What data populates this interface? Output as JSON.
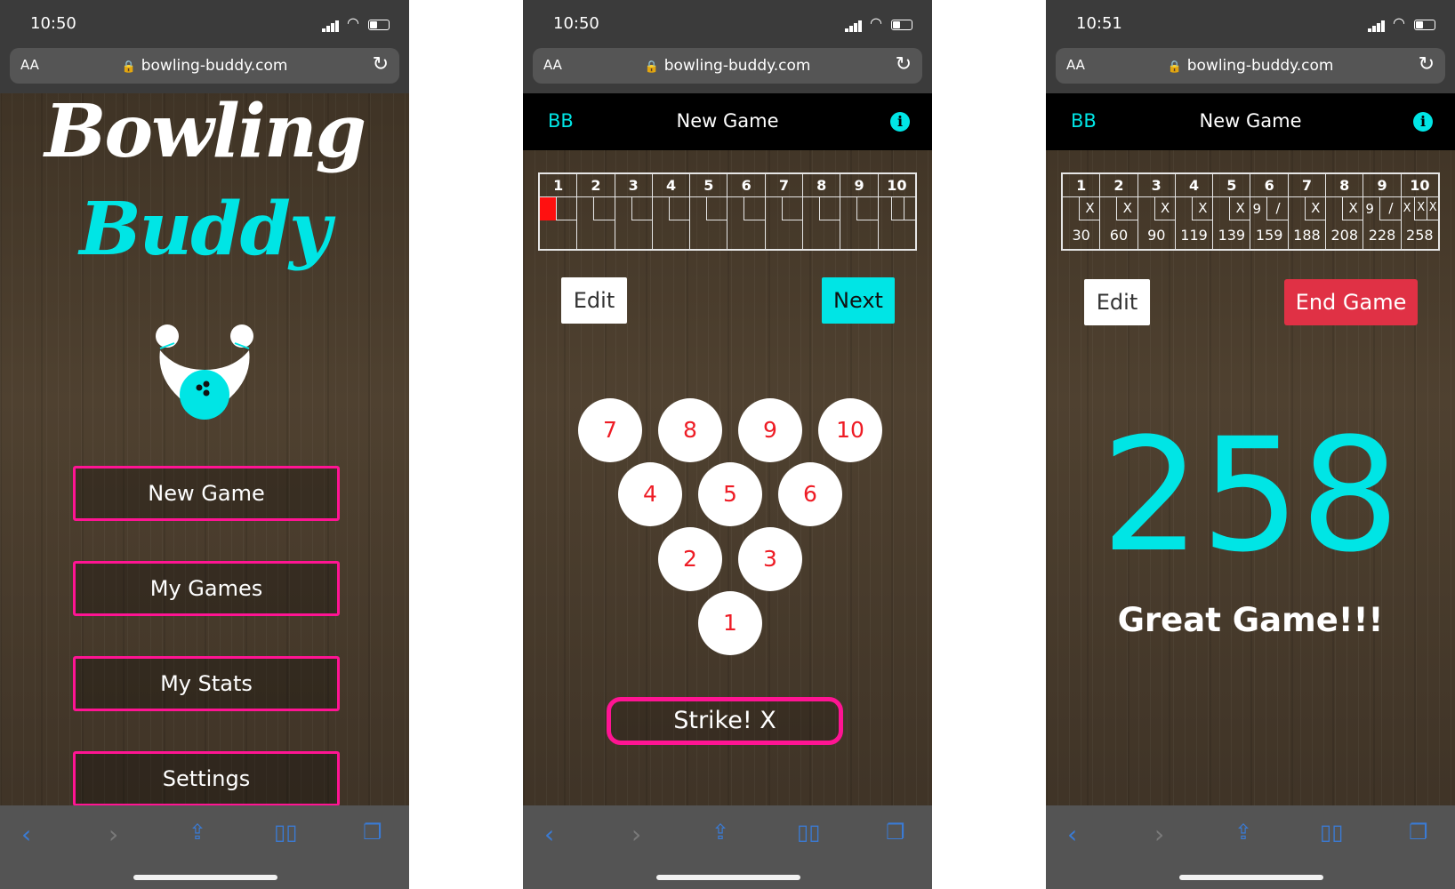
{
  "colors": {
    "accent": "#00e5e5",
    "menu_border": "#ff1493",
    "pin_text": "#ee1c25",
    "end_game": "#e03145",
    "current_marker": "#ff1010"
  },
  "browser": {
    "url": "bowling-buddy.com",
    "text_size_label": "AA"
  },
  "screens": [
    {
      "time": "10:50",
      "title_line1": "Bowling",
      "title_line2": "Buddy",
      "menu": [
        {
          "label": "New Game"
        },
        {
          "label": "My Games"
        },
        {
          "label": "My Stats"
        },
        {
          "label": "Settings"
        }
      ]
    },
    {
      "time": "10:50",
      "header": {
        "brand": "BB",
        "title": "New Game",
        "info_icon": "info-icon"
      },
      "frame_numbers": [
        "1",
        "2",
        "3",
        "4",
        "5",
        "6",
        "7",
        "8",
        "9",
        "10"
      ],
      "buttons": {
        "edit": "Edit",
        "next": "Next"
      },
      "pins": {
        "row4": [
          "7",
          "8",
          "9",
          "10"
        ],
        "row3": [
          "4",
          "5",
          "6"
        ],
        "row2": [
          "2",
          "3"
        ],
        "row1": [
          "1"
        ]
      },
      "strike_label": "Strike! X"
    },
    {
      "time": "10:51",
      "header": {
        "brand": "BB",
        "title": "New Game",
        "info_icon": "info-icon"
      },
      "frames": [
        {
          "num": "1",
          "r1": "",
          "r2": "X",
          "total": "30"
        },
        {
          "num": "2",
          "r1": "",
          "r2": "X",
          "total": "60"
        },
        {
          "num": "3",
          "r1": "",
          "r2": "X",
          "total": "90"
        },
        {
          "num": "4",
          "r1": "",
          "r2": "X",
          "total": "119"
        },
        {
          "num": "5",
          "r1": "",
          "r2": "X",
          "total": "139"
        },
        {
          "num": "6",
          "r1": "9",
          "r2": "/",
          "total": "159"
        },
        {
          "num": "7",
          "r1": "",
          "r2": "X",
          "total": "188"
        },
        {
          "num": "8",
          "r1": "",
          "r2": "X",
          "total": "208"
        },
        {
          "num": "9",
          "r1": "9",
          "r2": "/",
          "total": "228"
        },
        {
          "num": "10",
          "r1": "X",
          "r2": "X",
          "r3": "X",
          "total": "258"
        }
      ],
      "buttons": {
        "edit": "Edit",
        "end": "End Game"
      },
      "final_score": "258",
      "message": "Great Game!!!"
    }
  ]
}
